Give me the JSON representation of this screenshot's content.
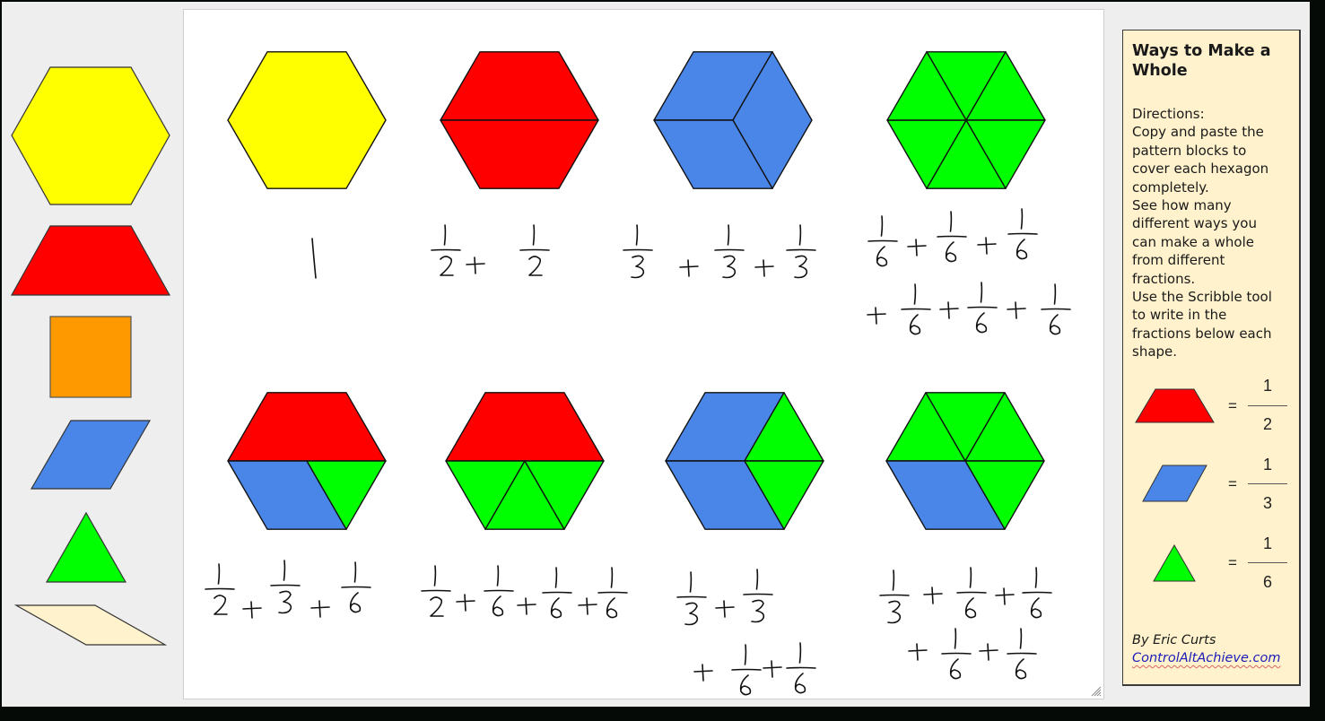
{
  "palette": {
    "blocks": [
      {
        "shape": "hexagon",
        "label": "yellow hexagon",
        "color": "#ffff00"
      },
      {
        "shape": "trapezoid",
        "label": "red trapezoid",
        "color": "#ff0000"
      },
      {
        "shape": "square",
        "label": "orange square",
        "color": "#ff9900"
      },
      {
        "shape": "rhombus",
        "label": "blue rhombus",
        "color": "#4a86e8"
      },
      {
        "shape": "triangle",
        "label": "green triangle",
        "color": "#00ff00"
      },
      {
        "shape": "thin-rhombus",
        "label": "tan thin rhombus",
        "color": "#fff2cc"
      }
    ]
  },
  "colors": {
    "yellow": "#ffff00",
    "red": "#ff0000",
    "orange": "#ff9900",
    "blue": "#4a86e8",
    "green": "#00ff00",
    "tan": "#fff2cc",
    "outline": "#222222"
  },
  "canvas": {
    "hexagons": [
      {
        "id": "hex-1",
        "fill": [
          "yellow"
        ],
        "fraction_text": "1"
      },
      {
        "id": "hex-2",
        "fill": [
          "red",
          "red"
        ],
        "fraction_text": "1/2 + 1/2"
      },
      {
        "id": "hex-3",
        "fill": [
          "blue",
          "blue",
          "blue"
        ],
        "fraction_text": "1/3 + 1/3 + 1/3"
      },
      {
        "id": "hex-4",
        "fill": [
          "green",
          "green",
          "green",
          "green",
          "green",
          "green"
        ],
        "fraction_text": "1/6 + 1/6 + 1/6 + 1/6 + 1/6 + 1/6"
      },
      {
        "id": "hex-5",
        "fill": [
          "red",
          "blue",
          "green"
        ],
        "fraction_text": "1/2 + 1/3 + 1/6"
      },
      {
        "id": "hex-6",
        "fill": [
          "red",
          "green",
          "green",
          "green"
        ],
        "fraction_text": "1/2 + 1/6 + 1/6 + 1/6"
      },
      {
        "id": "hex-7",
        "fill": [
          "blue",
          "blue",
          "green",
          "green"
        ],
        "fraction_text": "1/3 + 1/3 + 1/6 + 1/6"
      },
      {
        "id": "hex-8",
        "fill": [
          "green",
          "green",
          "green",
          "green",
          "blue"
        ],
        "fraction_text": "1/3 + 1/6 + 1/6 + 1/6 + 1/6"
      }
    ]
  },
  "info_panel": {
    "title_lines": [
      "Ways to Make a",
      "Whole"
    ],
    "directions_lines": [
      "Directions:",
      "Copy and paste the",
      "pattern blocks to",
      "cover each hexagon",
      "completely.",
      "See how many",
      "different ways you",
      "can make a whole",
      "from different",
      "fractions.",
      "Use the Scribble tool",
      "to write in the",
      "fractions below each",
      "shape."
    ],
    "legend": [
      {
        "shape": "trapezoid",
        "equals": "=",
        "numerator": "1",
        "denominator": "2"
      },
      {
        "shape": "rhombus",
        "equals": "=",
        "numerator": "1",
        "denominator": "3"
      },
      {
        "shape": "triangle",
        "equals": "=",
        "numerator": "1",
        "denominator": "6"
      }
    ],
    "credit_author": "By Eric Curts",
    "credit_link": "ControlAltAchieve.com"
  }
}
